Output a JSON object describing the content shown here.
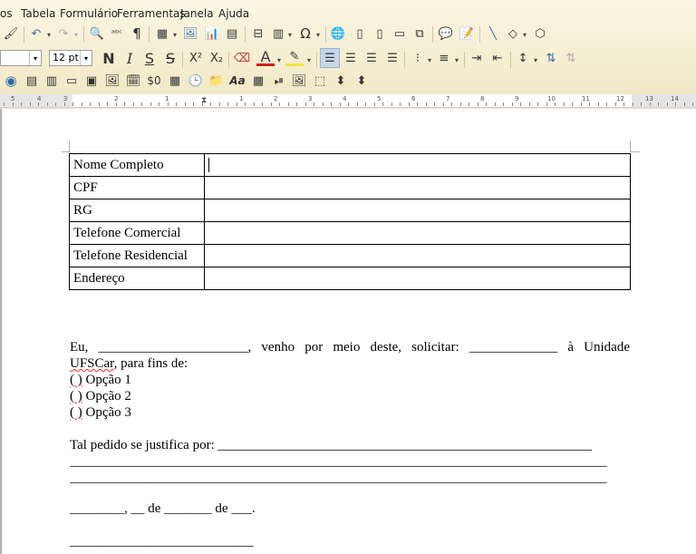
{
  "menu": [
    "os",
    "Tabela",
    "Formulário",
    "Ferramentas",
    "Janela",
    "Ajuda"
  ],
  "toolbar": {
    "font_size": "12 pt",
    "bold": "N",
    "italic": "I",
    "underline": "S",
    "strike": "S",
    "superscript": "X²",
    "subscript": "X₂",
    "font_color": "A",
    "currency": "$0",
    "style_aa": "Aa"
  },
  "ruler": [
    "5",
    "4",
    "3",
    "2",
    "1",
    "1",
    "2",
    "3",
    "4",
    "5",
    "6",
    "7",
    "8",
    "9",
    "10",
    "11",
    "12",
    "13",
    "14"
  ],
  "form_table": [
    {
      "label": "Nome Completo",
      "value": ""
    },
    {
      "label": "CPF",
      "value": ""
    },
    {
      "label": "RG",
      "value": ""
    },
    {
      "label": "Telefone Comercial",
      "value": ""
    },
    {
      "label": "Telefone Residencial",
      "value": ""
    },
    {
      "label": "Endereço",
      "value": ""
    }
  ],
  "body": {
    "p1_line1": "Eu, ______________________, venho por meio deste, solicitar: _____________ à Unidade",
    "p1_line2_word": "UFSCar",
    "p1_line2_rest": ", para fins de:",
    "option1_paren": "( )",
    "option1": " Opção 1",
    "option2_paren": "( )",
    "option2": " Opção 2",
    "option3_paren": "( )",
    "option3": " Opção 3",
    "justify_line1": "Tal pedido se justifica por: _______________________________________________________",
    "justify_line2": "_______________________________________________________________________________",
    "justify_line3": "_______________________________________________________________________________",
    "date_line": "________, __ de _______ de ___.",
    "signature_line": "___________________________"
  }
}
